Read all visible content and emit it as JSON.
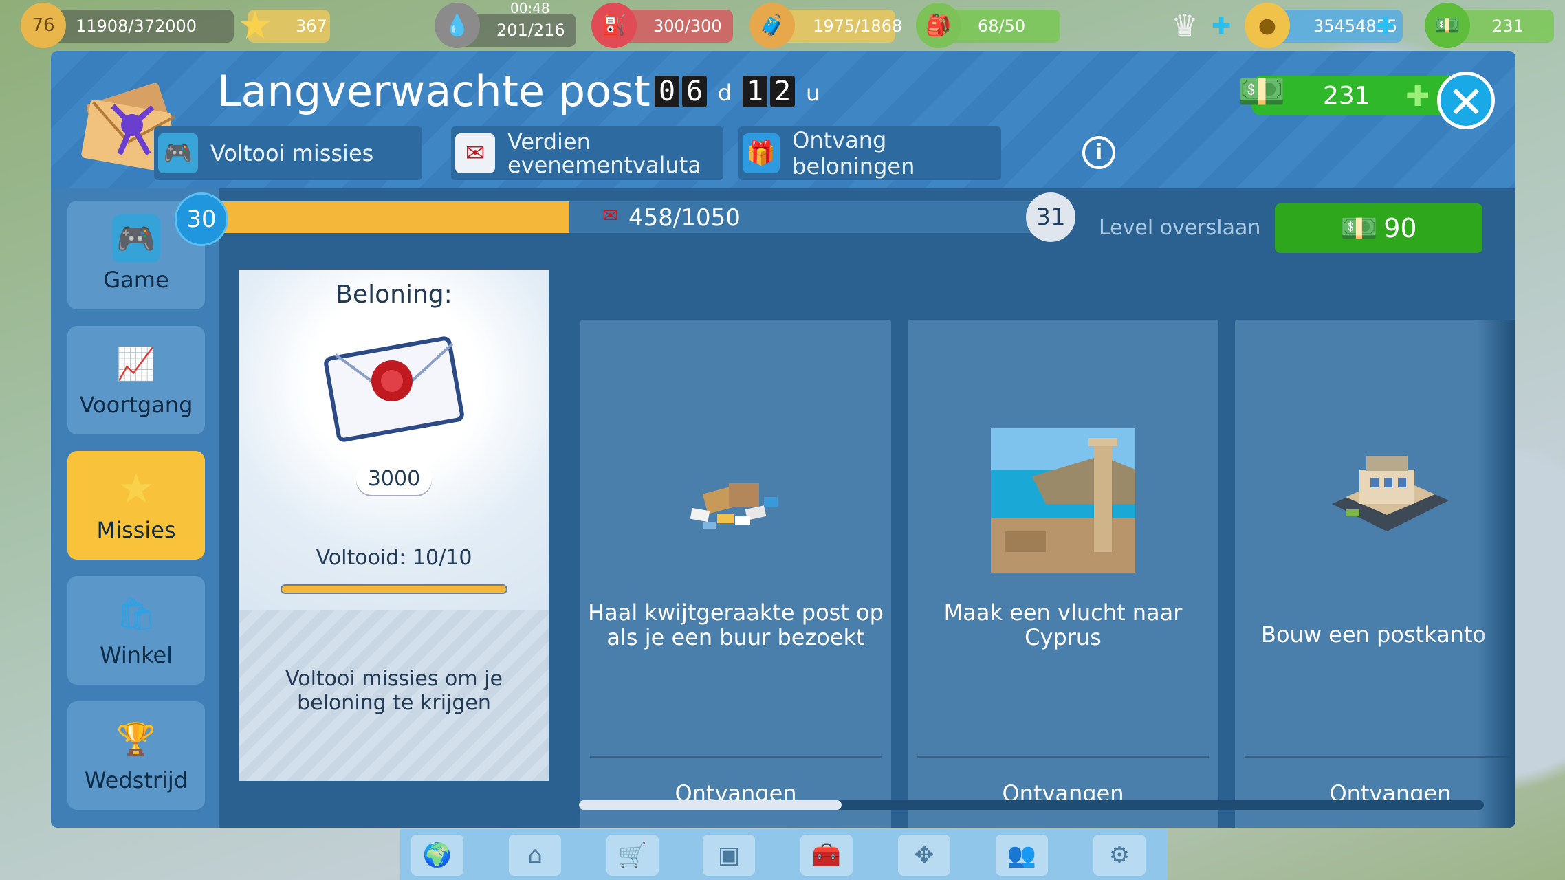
{
  "hud": {
    "level": "76",
    "xp": "11908/372000",
    "stars": "367",
    "time": "00:48",
    "fuel": "201/216",
    "fuel_cans": "300/300",
    "cargo": "1975/1868",
    "crew": "68/50",
    "coins": "35454855",
    "bucks": "231"
  },
  "dialog": {
    "title": "Langverwachte post",
    "timer": {
      "d1": "0",
      "d2": "6",
      "days_unit": "d",
      "h1": "1",
      "h2": "2",
      "hours_unit": "u"
    },
    "tabs": [
      "Voltooi missies",
      "Verdien evenementvaluta",
      "Ontvang beloningen"
    ],
    "money": "231",
    "close_label": "✕",
    "info_label": "i"
  },
  "sidebar": {
    "items": [
      {
        "label": "Game"
      },
      {
        "label": "Voortgang"
      },
      {
        "label": "Missies"
      },
      {
        "label": "Winkel"
      },
      {
        "label": "Wedstrijd"
      }
    ],
    "active": "Missies"
  },
  "progress": {
    "level_from": "30",
    "level_to": "31",
    "value": "458/1050",
    "fraction": 0.436,
    "skip_label": "Level overslaan",
    "skip_cost": "90"
  },
  "reward": {
    "header": "Beloning:",
    "amount": "3000",
    "completed": "Voltooid: 10/10",
    "completed_fraction": 1.0,
    "note": "Voltooi missies om je beloning te krijgen"
  },
  "missions": [
    {
      "text": "Haal kwijtgeraakte post op als je een buur bezoekt",
      "button": "Ontvangen",
      "image": "scattered-mail-icon"
    },
    {
      "text": "Maak een vlucht naar Cyprus",
      "button": "Ontvangen",
      "image": "cyprus-photo"
    },
    {
      "text": "Bouw een postkanto",
      "button": "Ontvangen",
      "image": "post-office-building-icon"
    }
  ],
  "colors": {
    "dialog_bg": "#1f4f78",
    "header": "#3f86c4",
    "accent_green": "#2fb82a",
    "accent_yellow": "#f5b73a",
    "close_blue": "#19a9e6"
  }
}
